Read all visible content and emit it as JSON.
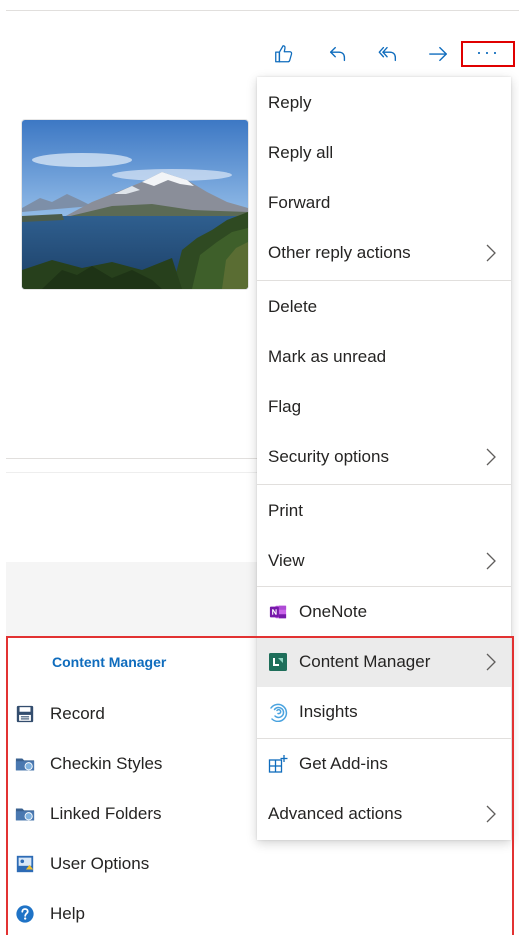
{
  "toolbar": {
    "like_icon": "thumbs-up-icon",
    "reply_icon": "reply-icon",
    "reply_all_icon": "reply-all-icon",
    "forward_icon": "forward-arrow-icon",
    "more_label": "···"
  },
  "menu": {
    "reply": "Reply",
    "reply_all": "Reply all",
    "forward": "Forward",
    "other_reply": "Other reply actions",
    "delete": "Delete",
    "mark_unread": "Mark as unread",
    "flag": "Flag",
    "security": "Security options",
    "print": "Print",
    "view": "View",
    "onenote": "OneNote",
    "content_manager": "Content Manager",
    "insights": "Insights",
    "get_addins": "Get Add-ins",
    "advanced": "Advanced actions"
  },
  "content_manager_panel": {
    "title": "Content Manager",
    "record": "Record",
    "checkin_styles": "Checkin Styles",
    "linked_folders": "Linked Folders",
    "user_options": "User Options",
    "help": "Help"
  },
  "colors": {
    "accent": "#0f6cbd",
    "highlight_border": "#e00000",
    "hover_bg": "#ebebeb"
  }
}
